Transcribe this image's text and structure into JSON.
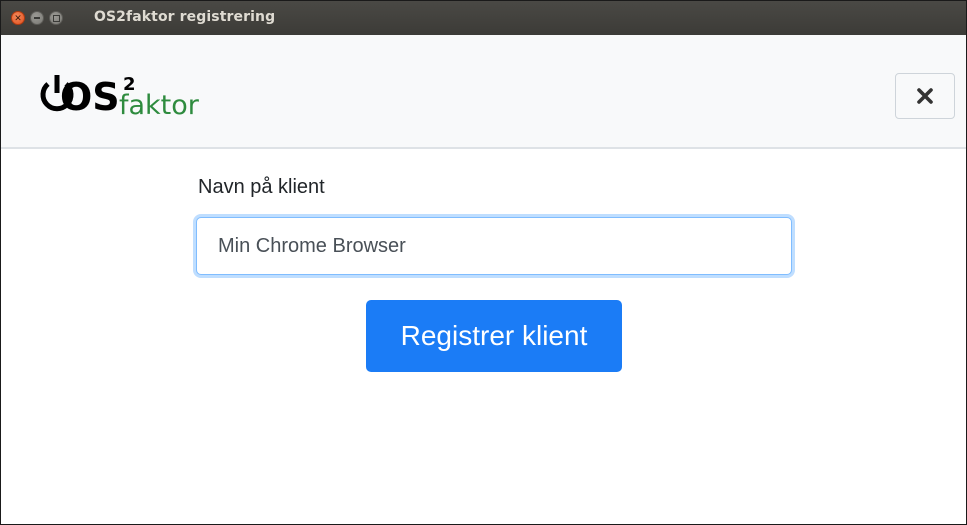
{
  "window": {
    "title": "OS2faktor registrering",
    "controls": {
      "close_icon": "close-icon",
      "minimize_icon": "minimize-icon",
      "maximize_icon": "maximize-icon"
    }
  },
  "header": {
    "logo": {
      "text_main": "OS",
      "superscript": "2",
      "text_sub": "faktor",
      "main_color": "#000000",
      "sub_color": "#2e8b3e"
    },
    "close_button_icon": "close-icon"
  },
  "form": {
    "label": "Navn på klient",
    "input_value": "Min Chrome Browser",
    "submit_label": "Registrer klient"
  },
  "colors": {
    "primary": "#1b7cf6",
    "header_bg": "#f8f9fa",
    "titlebar_bg": "#3c3b37"
  }
}
